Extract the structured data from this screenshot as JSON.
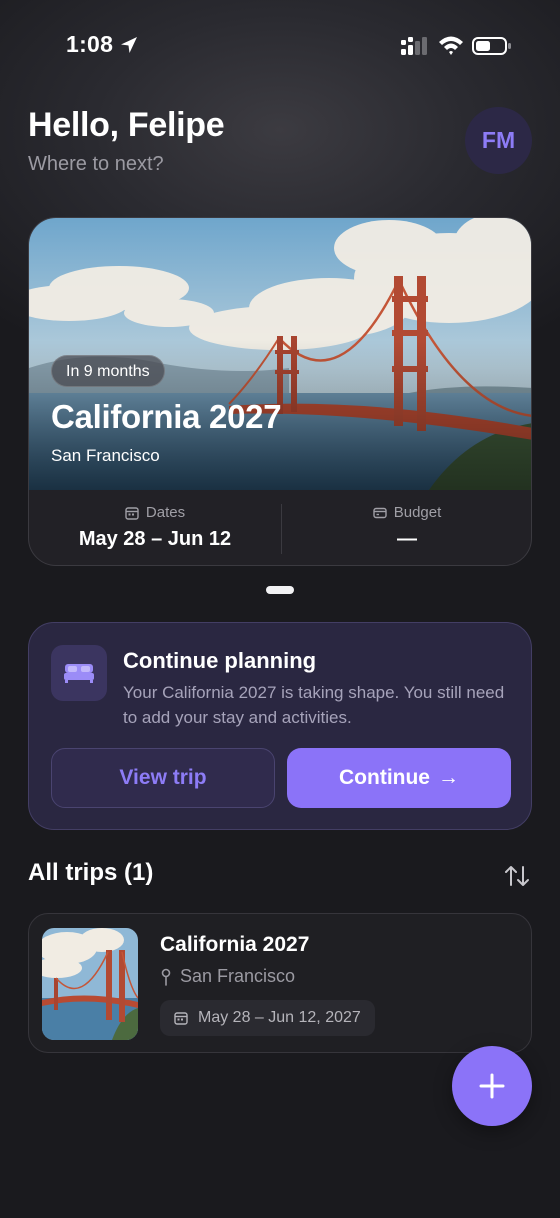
{
  "status_bar": {
    "time": "1:08"
  },
  "header": {
    "greeting": "Hello, Felipe",
    "subtitle": "Where to next?",
    "avatar_initials": "FM"
  },
  "hero": {
    "badge": "In 9 months",
    "title": "California 2027",
    "location": "San Francisco",
    "dates_label": "Dates",
    "dates_value": "May 28 – Jun 12",
    "budget_label": "Budget",
    "budget_value": "—"
  },
  "planning": {
    "title": "Continue planning",
    "description": "Your California 2027 is taking shape. You still need to add your stay and activities.",
    "view_button": "View trip",
    "continue_button": "Continue",
    "continue_arrow": "→"
  },
  "trips": {
    "section_title": "All trips (1)",
    "items": [
      {
        "title": "California 2027",
        "location": "San Francisco",
        "dates": "May 28 – Jun 12, 2027"
      }
    ]
  },
  "colors": {
    "accent": "#8b73f8",
    "background": "#18181c",
    "card": "#2a2741"
  },
  "icons": [
    "location-arrow-icon",
    "signal-icon",
    "wifi-icon",
    "battery-icon",
    "calendar-icon",
    "wallet-icon",
    "bed-icon",
    "arrow-right-icon",
    "sort-icon",
    "pin-icon",
    "plus-icon"
  ]
}
